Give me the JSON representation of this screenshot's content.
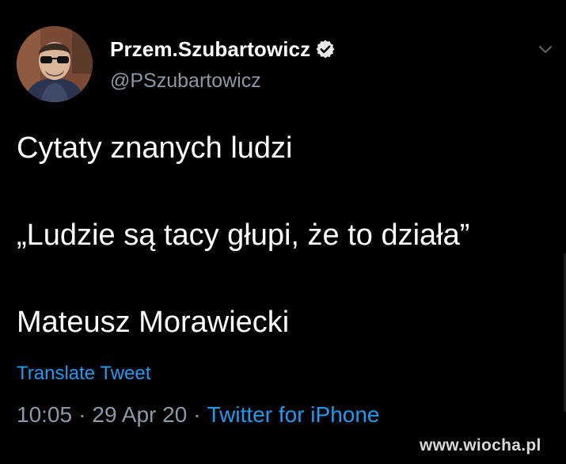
{
  "author": {
    "display_name": "Przem.Szubartowicz",
    "handle": "@PSzubartowicz",
    "avatar_icon": "user-avatar-photo",
    "verified_icon": "verified-badge-icon"
  },
  "tweet": {
    "lines": [
      "Cytaty znanych ludzi",
      "„Ludzie są tacy głupi, że to działa”",
      "Mateusz Morawiecki"
    ],
    "translate_label": "Translate Tweet"
  },
  "meta": {
    "time": "10:05",
    "date": "29 Apr 20",
    "separator": "·",
    "source": "Twitter for iPhone"
  },
  "watermark": "www.wiocha.pl",
  "colors": {
    "background": "#000000",
    "text": "#ffffff",
    "secondary": "#8b98a5",
    "link": "#1d9bf0"
  }
}
